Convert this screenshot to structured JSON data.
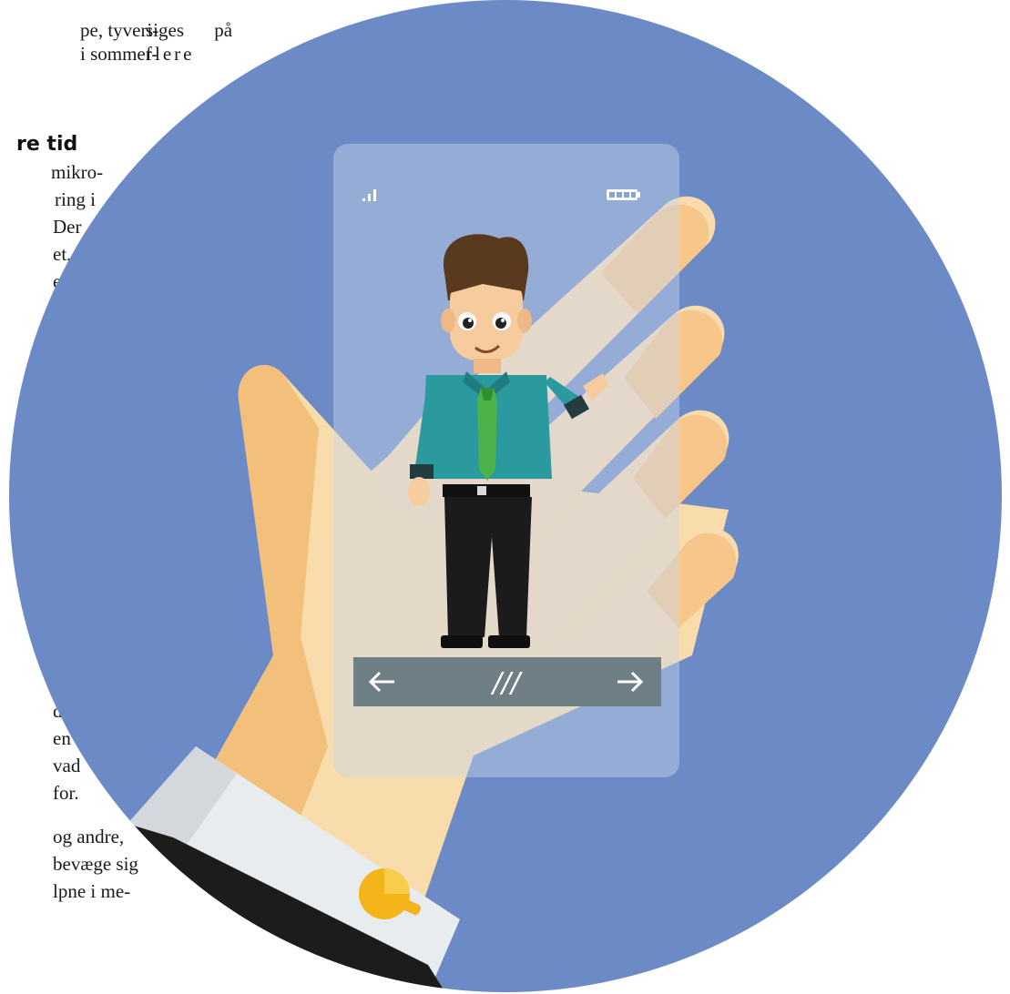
{
  "article": {
    "left_column": {
      "line1": "pe, tyveri-",
      "line2": "i sommer-",
      "heading": "re tid",
      "line3": "mikro-",
      "line4": "ring i",
      "line5": "Der",
      "line6": "et,",
      "line7": "e",
      "line8": "d",
      "line9": "en",
      "line10": "vad",
      "line11": "for.",
      "line12": "og andre,",
      "line13": "bevæge sig",
      "line14": "lpne i me-"
    },
    "right_column": {
      "line1": "siges på",
      "line2": "flere"
    }
  },
  "illustration": {
    "circle_color": "#6b8ac6",
    "phone_nav": {
      "back_icon": "arrow-left-icon",
      "handle_glyph": "///",
      "forward_icon": "arrow-right-icon"
    }
  }
}
